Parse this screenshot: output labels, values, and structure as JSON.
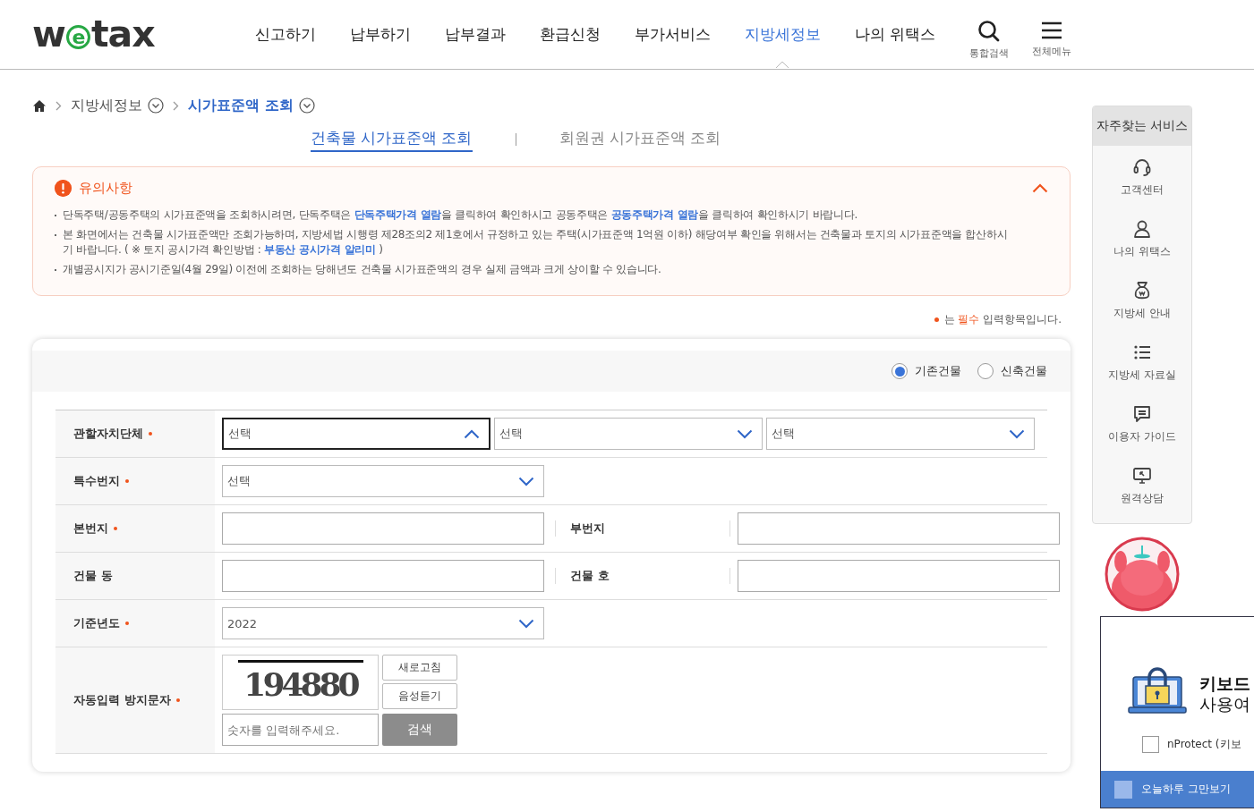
{
  "header": {
    "logo": "wetax",
    "nav": [
      {
        "label": "신고하기",
        "selected": false
      },
      {
        "label": "납부하기",
        "selected": false
      },
      {
        "label": "납부결과",
        "selected": false
      },
      {
        "label": "환급신청",
        "selected": false
      },
      {
        "label": "부가서비스",
        "selected": false
      },
      {
        "label": "지방세정보",
        "selected": true
      },
      {
        "label": "나의 위택스",
        "selected": false
      }
    ],
    "tools": [
      {
        "label": "통합검색",
        "kind": "search"
      },
      {
        "label": "전체메뉴",
        "kind": "menu"
      }
    ]
  },
  "breadcrumb": [
    {
      "label": "지방세정보",
      "selected": false
    },
    {
      "label": "시가표준액 조회",
      "selected": true
    }
  ],
  "tabs": [
    {
      "label": "건축물 시가표준액 조회",
      "selected": true
    },
    {
      "label": "회원권 시가표준액 조회",
      "selected": false
    }
  ],
  "notice": {
    "title": "유의사항",
    "expanded": true,
    "notes": [
      [
        {
          "text": "단독주택/공동주택의 시가표준액을 조회하시려면, 단독주택은 "
        },
        {
          "text": "단독주택가격 열람",
          "link": true
        },
        {
          "text": "을 클릭하여 확인하시고 공동주택은 "
        },
        {
          "text": "공동주택가격 열람",
          "link": true
        },
        {
          "text": "을 클릭하여 확인하시기 바랍니다."
        }
      ],
      [
        {
          "text": "본 화면에서는 건축물 시가표준액만 조회가능하며, 지방세법 시행령 제28조의2 제1호에서 규정하고 있는 주택(시가표준액 1억원 이하) 해당여부 확인을 위해서는 건축물과 토지의 시가표준액을 합산하시기 바랍니다. ( ※ 토지 공시가격 확인방법 : "
        },
        {
          "text": "부동산 공시가격 알리미",
          "link": true
        },
        {
          "text": " )"
        }
      ],
      [
        {
          "text": "개별공시지가 공시기준일(4월 29일) 이전에 조회하는 당해년도 건축물 시가표준액의 경우 실제 금액과 크게 상이할 수 있습니다."
        }
      ]
    ]
  },
  "required_note": {
    "before": "는 ",
    "emphasis": "필수",
    "after": " 입력항목입니다."
  },
  "building_type": [
    {
      "label": "기존건물",
      "selected": true
    },
    {
      "label": "신축건물",
      "selected": false
    }
  ],
  "rows": [
    {
      "cells": [
        {
          "kind": "label",
          "text": "관할자치단체",
          "required": true
        },
        {
          "kind": "select",
          "value": "선택",
          "expanded": true
        },
        {
          "kind": "select",
          "value": "선택",
          "expanded": false
        },
        {
          "kind": "select",
          "value": "선택",
          "expanded": false
        }
      ]
    },
    {
      "cells": [
        {
          "kind": "label",
          "text": "특수번지",
          "required": true
        },
        {
          "kind": "select",
          "value": "선택",
          "expanded": false
        }
      ]
    },
    {
      "cells": [
        {
          "kind": "label",
          "text": "본번지",
          "required": true
        },
        {
          "kind": "input"
        },
        {
          "kind": "label",
          "text": "부번지",
          "required": false
        },
        {
          "kind": "input"
        }
      ]
    },
    {
      "cells": [
        {
          "kind": "label",
          "text": "건물 동",
          "required": false
        },
        {
          "kind": "input"
        },
        {
          "kind": "label",
          "text": "건물 호",
          "required": false
        },
        {
          "kind": "input"
        }
      ]
    },
    {
      "cells": [
        {
          "kind": "label",
          "text": "기준년도",
          "required": true
        },
        {
          "kind": "select",
          "value": "2022",
          "expanded": false
        }
      ]
    },
    {
      "cells": [
        {
          "kind": "label",
          "text": "자동입력 방지문자",
          "required": true
        },
        {
          "kind": "captcha",
          "code": "194880",
          "buttons": [
            "새로고침",
            "음성듣기"
          ],
          "placeholder": "숫자를 입력해주세요.",
          "submit": "검색"
        }
      ]
    }
  ],
  "sidebar": {
    "title": "자주찾는 서비스",
    "items": [
      {
        "label": "고객센터",
        "kind": "headset"
      },
      {
        "label": "나의 위택스",
        "kind": "person"
      },
      {
        "label": "지방세 안내",
        "kind": "moneybag"
      },
      {
        "label": "지방세 자료실",
        "kind": "list"
      },
      {
        "label": "이용자 가이드",
        "kind": "chat"
      },
      {
        "label": "원격상담",
        "kind": "monitor"
      }
    ]
  },
  "popup": {
    "title_lines": [
      "키보드",
      "사용여"
    ],
    "option": {
      "label": "nProtect (키보",
      "checked": false
    },
    "footer": {
      "label": "오늘하루 그만보기",
      "checked": false
    }
  }
}
